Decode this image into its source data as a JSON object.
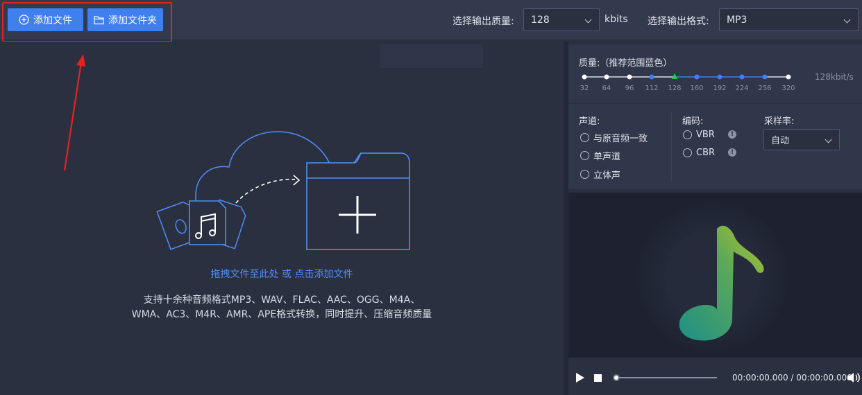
{
  "toolbar": {
    "add_file_label": "添加文件",
    "add_folder_label": "添加文件夹",
    "quality_label": "选择输出质量:",
    "quality_value": "128",
    "quality_unit": "kbits",
    "format_label": "选择输出格式:",
    "format_value": "MP3"
  },
  "drop": {
    "hint": "拖拽文件至此处 或 点击添加文件",
    "desc_line1": "支持十余种音频格式MP3、WAV、FLAC、AAC、OGG、M4A、",
    "desc_line2": "WMA、AC3、M4R、AMR、APE格式转换，同时提升、压缩音频质量"
  },
  "quality": {
    "title": "质量:（推荐范围蓝色）",
    "ticks": [
      "32",
      "64",
      "96",
      "112",
      "128",
      "160",
      "192",
      "224",
      "256",
      "320"
    ],
    "current": "128kbit/s",
    "selected_index": 4
  },
  "channel": {
    "title": "声道:",
    "options": [
      "与原音频一致",
      "单声道",
      "立体声"
    ]
  },
  "encoding": {
    "title": "编码:",
    "options": [
      "VBR",
      "CBR"
    ],
    "info": "!"
  },
  "sample_rate": {
    "title": "采样率:",
    "value": "自动"
  },
  "player": {
    "time": "00:00:00.000 / 00:00:00.000"
  },
  "colors": {
    "accent": "#3f7ff0",
    "highlight": "#e52222",
    "marker": "#2fc34a"
  },
  "icons": {
    "add_file": "plus-circle-icon",
    "add_folder": "folder-icon",
    "play": "play-icon",
    "stop": "stop-icon",
    "volume": "volume-icon",
    "note": "music-note-icon"
  }
}
